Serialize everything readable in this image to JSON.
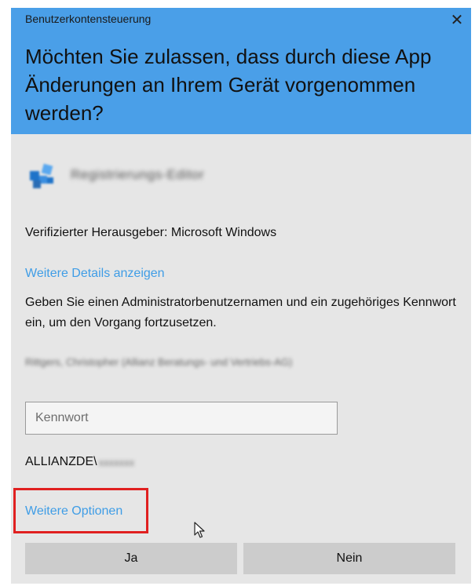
{
  "dialog": {
    "title": "Benutzerkontensteuerung",
    "close_glyph": "✕",
    "question": "Möchten Sie zulassen, dass durch diese App Änderungen an Ihrem Gerät vorgenommen werden?",
    "header_color": "#4a9fe8"
  },
  "app": {
    "icon": "registry-editor-icon",
    "name": "Registrierungs-Editor"
  },
  "publisher": "Verifizierter Herausgeber: Microsoft Windows",
  "details_link": "Weitere Details anzeigen",
  "instruction": "Geben Sie einen Administratorbenutzernamen und ein zugehöriges Kennwort ein, um den Vorgang fortzusetzen.",
  "user": {
    "display_name": "Rittgers, Christopher (Allianz Beratungs- und Vertriebs-AG)"
  },
  "password": {
    "placeholder": "Kennwort",
    "value": ""
  },
  "domain": {
    "prefix": "ALLIANZDE\\",
    "account": "xxxxxxx"
  },
  "more_options": "Weitere Optionen",
  "buttons": {
    "yes": "Ja",
    "no": "Nein"
  },
  "colors": {
    "link": "#3f9de6",
    "highlight_frame": "#e02020",
    "button_bg": "#cccccc",
    "body_bg": "#e6e6e6"
  }
}
